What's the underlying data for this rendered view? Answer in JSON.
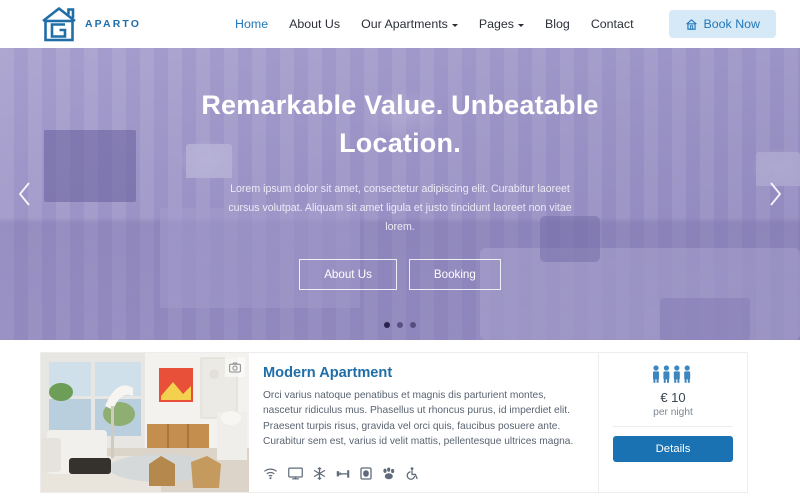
{
  "header": {
    "logo": {
      "text": "APARTO",
      "icon": "house-g-logo-icon",
      "color": "#1f6ea8"
    },
    "nav": [
      {
        "label": "Home",
        "active": true,
        "dropdown": false
      },
      {
        "label": "About Us",
        "active": false,
        "dropdown": false
      },
      {
        "label": "Our Apartments",
        "active": false,
        "dropdown": true
      },
      {
        "label": "Pages",
        "active": false,
        "dropdown": true
      },
      {
        "label": "Blog",
        "active": false,
        "dropdown": false
      },
      {
        "label": "Contact",
        "active": false,
        "dropdown": false
      }
    ],
    "book_button": {
      "label": "Book Now",
      "icon": "home-icon",
      "bg": "#d6e9f6",
      "color": "#2277b9"
    }
  },
  "hero": {
    "title": "Remarkable Value. Unbeatable Location.",
    "subtitle": "Lorem ipsum dolor sit amet, consectetur adipiscing elit. Curabitur laoreet cursus volutpat. Aliquam sit amet ligula et justo tincidunt laoreet non vitae lorem.",
    "buttons": [
      {
        "label": "About Us"
      },
      {
        "label": "Booking"
      }
    ],
    "prev_icon": "chevron-left-icon",
    "next_icon": "chevron-right-icon",
    "slides": 3,
    "active_slide": 1,
    "overlay_color": "#7c72b4"
  },
  "listing": {
    "thumbnail_badge_icon": "camera-icon",
    "title": "Modern Apartment",
    "description": "Orci varius natoque penatibus et magnis dis parturient montes, nascetur ridiculus mus. Phasellus ut rhoncus purus, id imperdiet elit. Praesent turpis risus, gravida vel orci quis, faucibus posuere ante. Curabitur sem est, varius id velit mattis, pellentesque ultrices magna.",
    "amenities": [
      {
        "name": "wifi-icon"
      },
      {
        "name": "tv-icon"
      },
      {
        "name": "air-conditioning-icon"
      },
      {
        "name": "gym-icon"
      },
      {
        "name": "minibar-icon"
      },
      {
        "name": "pets-allowed-icon"
      },
      {
        "name": "wheelchair-accessible-icon"
      }
    ],
    "guests_icon": "guests-icon",
    "guests_count": 4,
    "price": "€ 10",
    "price_unit": "per night",
    "details_button": {
      "label": "Details",
      "bg": "#1a72b2"
    }
  }
}
